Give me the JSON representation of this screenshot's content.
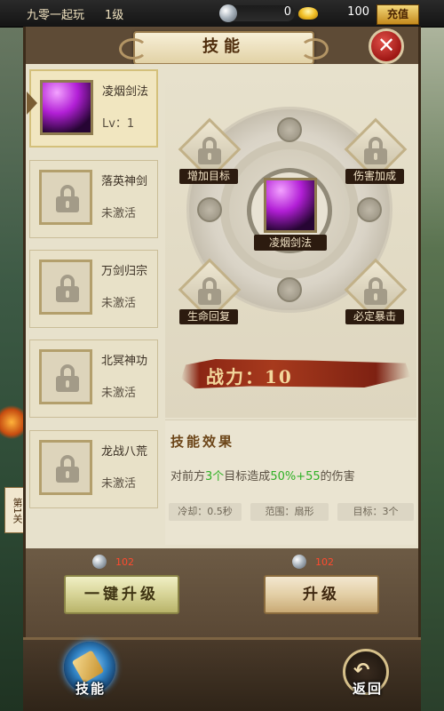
{
  "topbar": {
    "player_name": "九零一起玩",
    "player_level": "1级",
    "silver_amount": "0",
    "gold_amount": "100",
    "recharge_label": "充值"
  },
  "panel": {
    "title": "技能",
    "close_icon": "close-x-icon"
  },
  "skill_list": [
    {
      "name": "凌烟剑法",
      "status": "Lv：1",
      "unlocked": true,
      "selected": true
    },
    {
      "name": "落英神剑",
      "status": "未激活",
      "unlocked": false,
      "selected": false
    },
    {
      "name": "万剑归宗",
      "status": "未激活",
      "unlocked": false,
      "selected": false
    },
    {
      "name": "北冥神功",
      "status": "未激活",
      "unlocked": false,
      "selected": false
    },
    {
      "name": "龙战八荒",
      "status": "未激活",
      "unlocked": false,
      "selected": false
    }
  ],
  "skill_wheel": {
    "center_label": "凌烟剑法",
    "nodes": {
      "top_left": "增加目标",
      "top_right": "伤害加成",
      "bottom_left": "生命回复",
      "bottom_right": "必定暴击"
    }
  },
  "power": {
    "label": "战力：10"
  },
  "effect": {
    "title": "技能效果",
    "desc_prefix": "对前方",
    "desc_targets": "3个",
    "desc_mid": "目标造成",
    "desc_damage": "50%+55",
    "desc_suffix": "的伤害",
    "cooldown": "冷却：0.5秒",
    "range": "范围：扇形",
    "target": "目标：3个"
  },
  "actions": {
    "onekey_cost": "102",
    "onekey_label": "一键升级",
    "upgrade_cost": "102",
    "upgrade_label": "升级"
  },
  "bottom_nav": {
    "skill_label": "技能",
    "back_label": "返回"
  },
  "side": {
    "tab_label": "第1关"
  },
  "colors": {
    "highlight_green": "#2fb025",
    "cost_red": "#ff4a2e",
    "panel_brown": "#5e4b36"
  }
}
